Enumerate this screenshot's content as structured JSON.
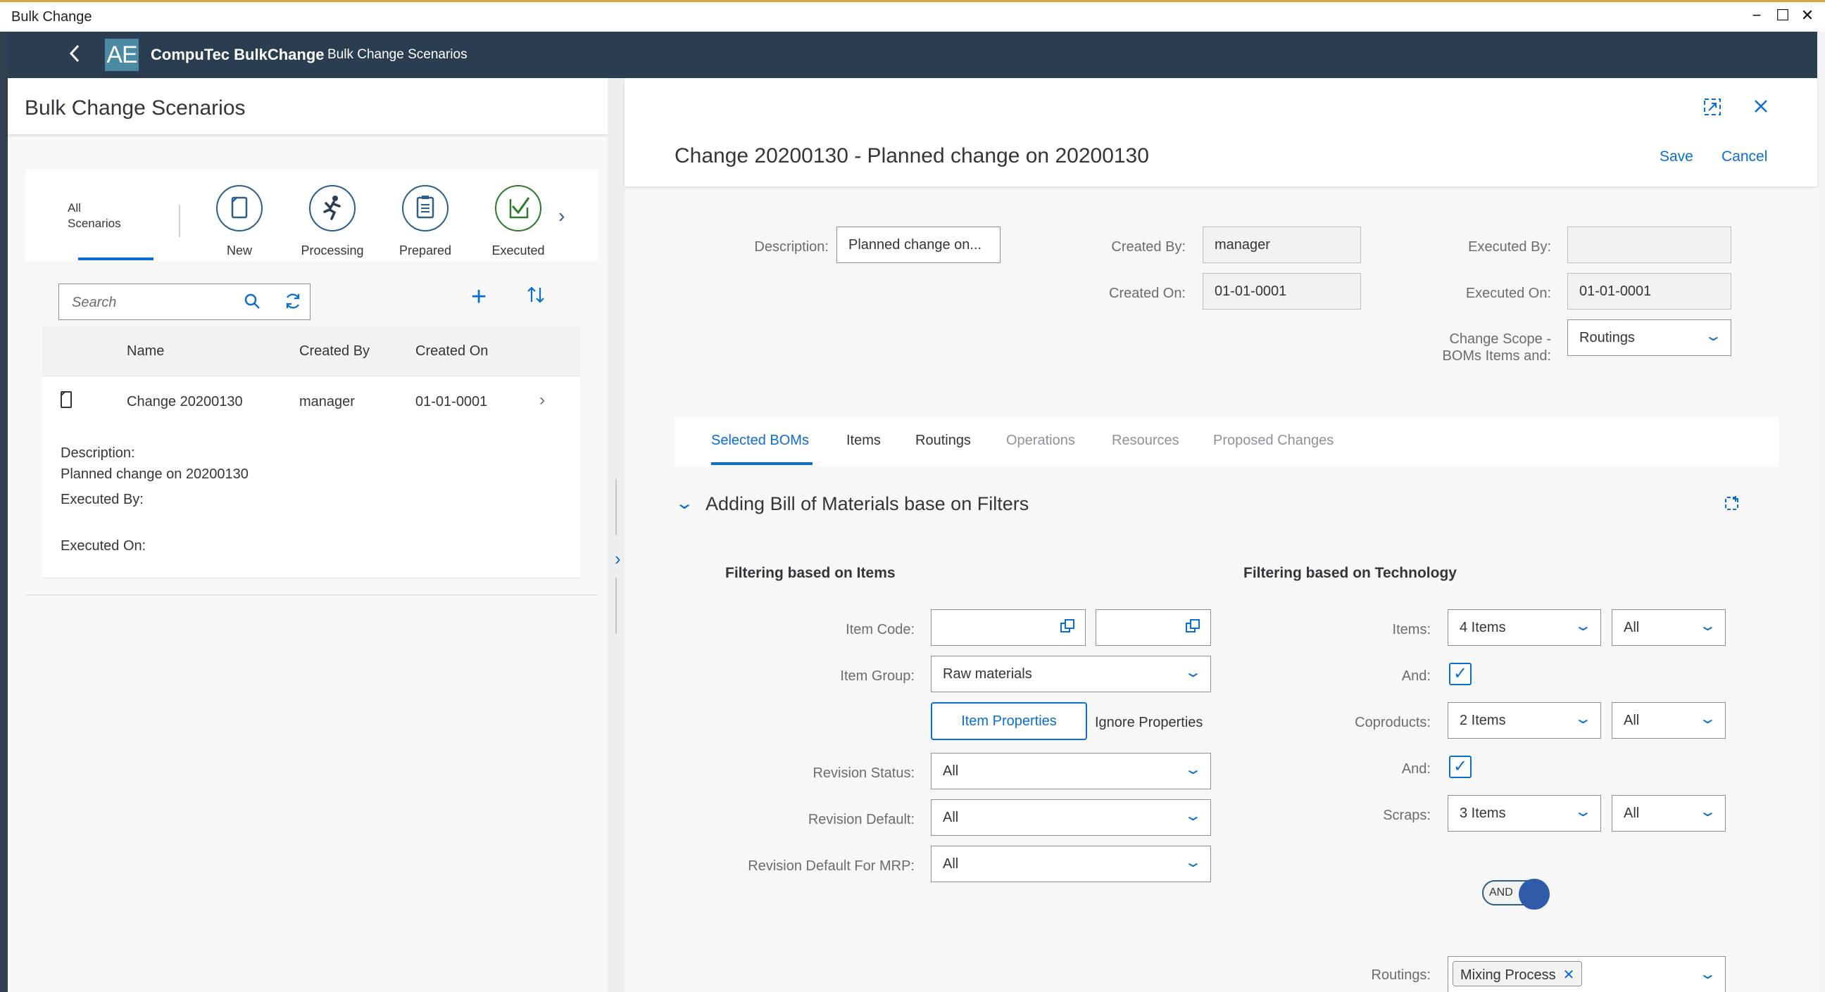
{
  "window": {
    "title": "Bulk Change",
    "controls": [
      "−",
      "☐",
      "✕"
    ]
  },
  "shell": {
    "logo_text": "AE",
    "app_name": "CompuTec BulkChange",
    "page_name": "Bulk Change Scenarios"
  },
  "master": {
    "title": "Bulk Change Scenarios",
    "filters": {
      "all_label_line1": "All",
      "all_label_line2": "Scenarios",
      "new": "New",
      "processing": "Processing",
      "prepared": "Prepared",
      "executed": "Executed"
    },
    "search_placeholder": "Search",
    "table": {
      "columns": [
        "Name",
        "Created By",
        "Created On"
      ],
      "rows": [
        {
          "name": "Change 20200130",
          "created_by": "manager",
          "created_on": "01-01-0001",
          "description_label": "Description:",
          "description_value": "Planned change on 20200130",
          "executed_by_label": "Executed By:",
          "executed_on_label": "Executed On:"
        }
      ]
    }
  },
  "detail": {
    "title": "Change 20200130 - Planned change on 20200130",
    "save_label": "Save",
    "cancel_label": "Cancel",
    "fields": {
      "description_label": "Description:",
      "description_value": "Planned change on...",
      "created_by_label": "Created By:",
      "created_by_value": "manager",
      "created_on_label": "Created On:",
      "created_on_value": "01-01-0001",
      "executed_by_label": "Executed By:",
      "executed_by_value": "",
      "executed_on_label": "Executed On:",
      "executed_on_value": "01-01-0001",
      "scope_label_line1": "Change Scope -",
      "scope_label_line2": "BOMs Items and:",
      "scope_value": "Routings"
    },
    "tabs": [
      {
        "label": "Selected BOMs",
        "state": "active"
      },
      {
        "label": "Items",
        "state": "normal"
      },
      {
        "label": "Routings",
        "state": "normal"
      },
      {
        "label": "Operations",
        "state": "disabled"
      },
      {
        "label": "Resources",
        "state": "disabled"
      },
      {
        "label": "Proposed Changes",
        "state": "disabled"
      }
    ],
    "panel_title": "Adding Bill of Materials base on Filters",
    "items_section": {
      "title": "Filtering based on Items",
      "item_code_label": "Item Code:",
      "item_code_from": "",
      "item_code_to": "",
      "item_group_label": "Item Group:",
      "item_group_value": "Raw materials",
      "item_properties_button": "Item Properties",
      "ignore_properties": "Ignore Properties",
      "revision_status_label": "Revision Status:",
      "revision_status_value": "All",
      "revision_default_label": "Revision Default:",
      "revision_default_value": "All",
      "revision_default_mrp_label": "Revision Default For MRP:",
      "revision_default_mrp_value": "All"
    },
    "tech_section": {
      "title": "Filtering based on Technology",
      "items_label": "Items:",
      "items_value": "4 Items",
      "items_mode": "All",
      "and1_label": "And:",
      "coproducts_label": "Coproducts:",
      "coproducts_value": "2 Items",
      "coproducts_mode": "All",
      "and2_label": "And:",
      "scraps_label": "Scraps:",
      "scraps_value": "3 Items",
      "scraps_mode": "All",
      "switch_label": "AND",
      "routings_label": "Routings:",
      "routings_token": "Mixing Process"
    }
  }
}
